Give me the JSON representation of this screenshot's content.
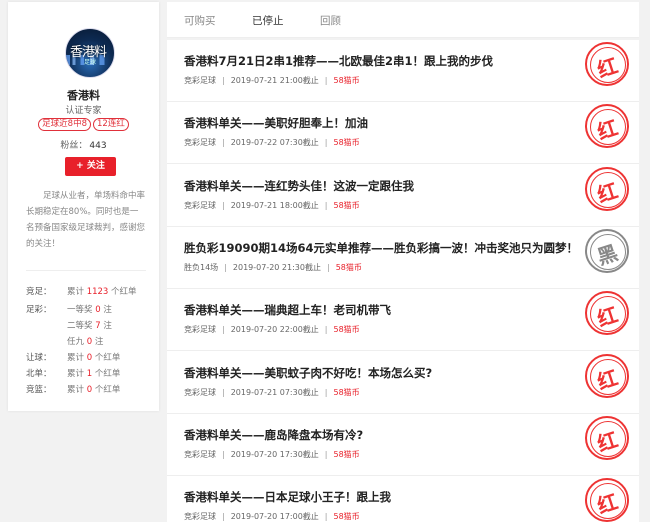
{
  "profile": {
    "avatar_text": "香港料",
    "avatar_subtext": "足球",
    "name": "香港料",
    "role": "认证专家",
    "tags": [
      "足球近8中8",
      "12连红"
    ],
    "fans_label": "粉丝：",
    "fans_count": "443",
    "follow_label": "+ 关注",
    "intro": "足球从业者，单场料命中率长期稳定在80%。同时也是一名预备国家级足球裁判，感谢您的关注！",
    "stats": [
      {
        "label": "竞足：",
        "pre": "累计 ",
        "num": "1123",
        "post": " 个红单"
      },
      {
        "label": "足彩：",
        "pre": "一等奖 ",
        "num": "0",
        "post": " 注"
      },
      {
        "label": "",
        "pre": "二等奖 ",
        "num": "7",
        "post": " 注"
      },
      {
        "label": "",
        "pre": "任九 ",
        "num": "0",
        "post": " 注"
      },
      {
        "label": "让球：",
        "pre": "累计 ",
        "num": "0",
        "post": " 个红单"
      },
      {
        "label": "北单：",
        "pre": "累计 ",
        "num": "1",
        "post": " 个红单"
      },
      {
        "label": "竞篮：",
        "pre": "累计 ",
        "num": "0",
        "post": " 个红单"
      }
    ]
  },
  "tabs": [
    {
      "label": "可购买",
      "active": false
    },
    {
      "label": "已停止",
      "active": true
    },
    {
      "label": "回顾",
      "active": false
    }
  ],
  "items": [
    {
      "title": "香港料7月21日2串1推荐——北欧最佳2串1！跟上我的步伐",
      "category": "竞彩足球",
      "time": "2019-07-21 21:00截止",
      "price": "58猫币",
      "stamp": "红",
      "stamp_color": "#e33"
    },
    {
      "title": "香港料单关——美职好胆奉上！加油",
      "category": "竞彩足球",
      "time": "2019-07-22 07:30截止",
      "price": "58猫币",
      "stamp": "红",
      "stamp_color": "#e33"
    },
    {
      "title": "香港料单关——连红势头佳！这波一定跟住我",
      "category": "竞彩足球",
      "time": "2019-07-21 18:00截止",
      "price": "58猫币",
      "stamp": "红",
      "stamp_color": "#e33"
    },
    {
      "title": "胜负彩19090期14场64元实单推荐——胜负彩搞一波！冲击奖池只为圆梦！",
      "category": "胜负14场",
      "time": "2019-07-20 21:30截止",
      "price": "58猫币",
      "stamp": "黑",
      "stamp_color": "#888"
    },
    {
      "title": "香港料单关——瑞典超上车！老司机带飞",
      "category": "竞彩足球",
      "time": "2019-07-20 22:00截止",
      "price": "58猫币",
      "stamp": "红",
      "stamp_color": "#e33"
    },
    {
      "title": "香港料单关——美职蚊子肉不好吃！本场怎么买?",
      "category": "竞彩足球",
      "time": "2019-07-21 07:30截止",
      "price": "58猫币",
      "stamp": "红",
      "stamp_color": "#e33"
    },
    {
      "title": "香港料单关——鹿岛降盘本场有冷?",
      "category": "竞彩足球",
      "time": "2019-07-20 17:30截止",
      "price": "58猫币",
      "stamp": "红",
      "stamp_color": "#e33"
    },
    {
      "title": "香港料单关——日本足球小王子！跟上我",
      "category": "竞彩足球",
      "time": "2019-07-20 17:00截止",
      "price": "58猫币",
      "stamp": "红",
      "stamp_color": "#e33"
    }
  ]
}
